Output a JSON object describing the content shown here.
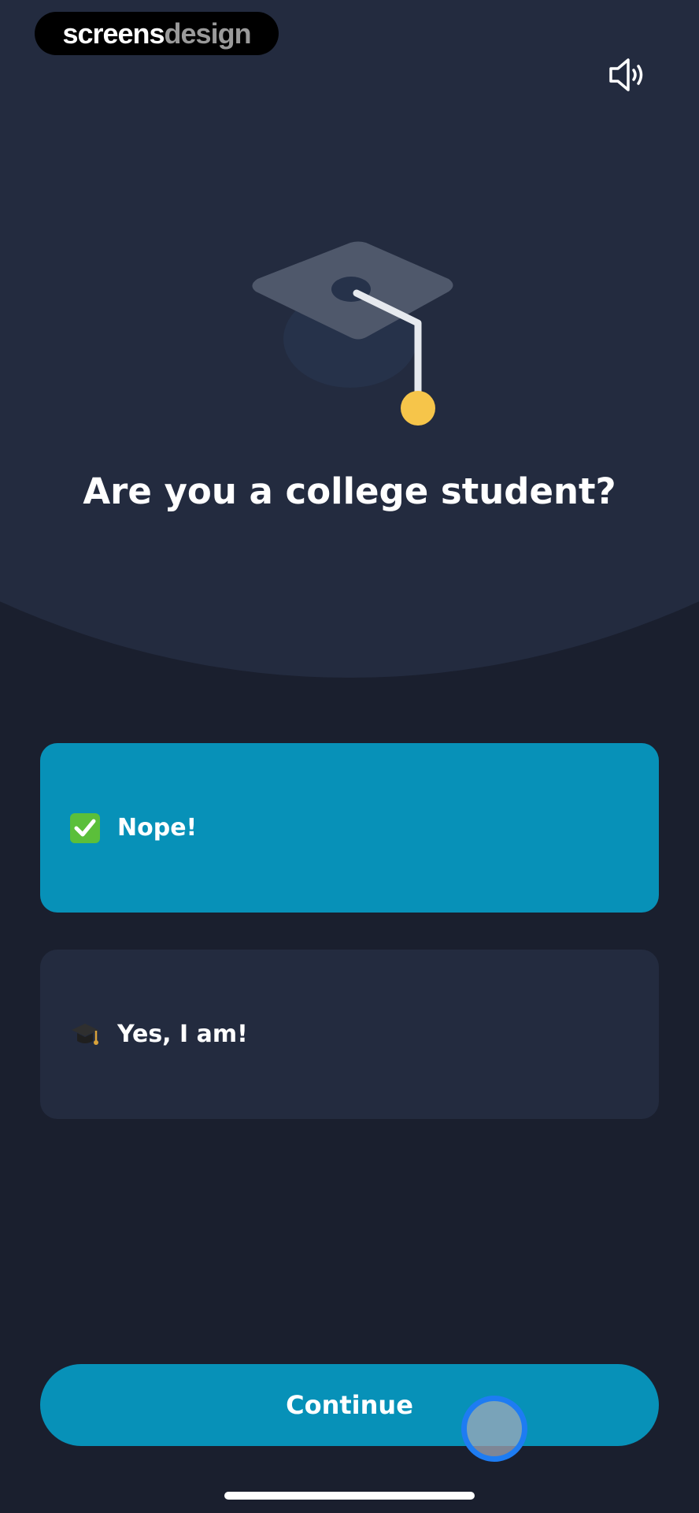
{
  "brand": {
    "part1": "screens",
    "part2": "design"
  },
  "header": {
    "sound_icon": "speaker-icon"
  },
  "hero": {
    "icon": "graduation-cap-illustration",
    "title": "Are you a college student?"
  },
  "options": [
    {
      "label": "Nope!",
      "icon": "check-mark-emoji",
      "selected": true
    },
    {
      "label": "Yes, I am!",
      "icon": "graduation-cap-emoji",
      "selected": false
    }
  ],
  "continue_button": {
    "label": "Continue"
  },
  "colors": {
    "background": "#1a1f2e",
    "arc": "#232b3f",
    "accent": "#0791b8",
    "card": "#232b3f",
    "tassel": "#f6c54a",
    "check_green": "#5bbf3a"
  }
}
